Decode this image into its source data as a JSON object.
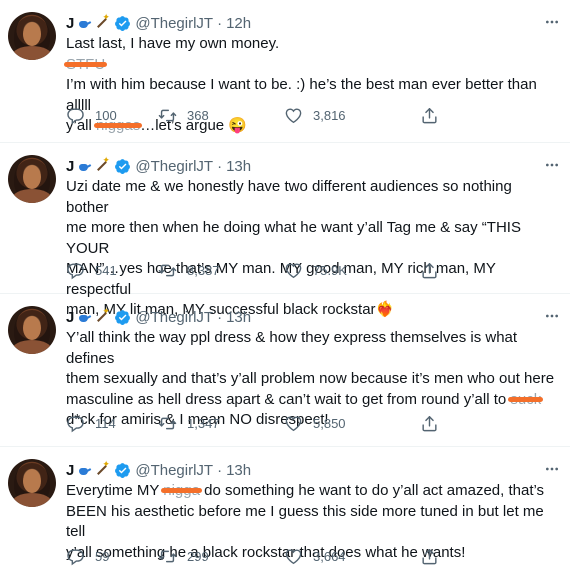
{
  "tweets": [
    {
      "name": "J",
      "handle": "@ThegirlJT",
      "separator": "·",
      "time": "12h",
      "lines": [
        {
          "text": "Last last, I have my own money."
        },
        {
          "parts": [
            {
              "redact": "STFU"
            }
          ]
        },
        {
          "text": "I’m with him because I want to be. :) he’s the best man ever better than alllll"
        },
        {
          "parts": [
            {
              "text": "y’all "
            },
            {
              "redact": "niggas"
            },
            {
              "text": "…let’s argue 😜"
            }
          ]
        }
      ],
      "replies": "100",
      "retweets": "368",
      "likes": "3,816"
    },
    {
      "name": "J",
      "handle": "@ThegirlJT",
      "separator": "·",
      "time": "13h",
      "lines": [
        {
          "text": "Uzi date me & we honestly have two different audiences so nothing bother"
        },
        {
          "text": "me more then when he doing what he want y’all Tag me & say “THIS YOUR"
        },
        {
          "text": "MAN”…yes hoe that’s MY man. MY good man, MY rich man, MY respectful"
        },
        {
          "text": "man, MY lit man, MY successful black rockstar❤️‍🔥"
        }
      ],
      "replies": "541",
      "retweets": "8,387",
      "likes": "75.9K"
    },
    {
      "name": "J",
      "handle": "@ThegirlJT",
      "separator": "·",
      "time": "13h",
      "lines": [
        {
          "text": "Y’all think the way ppl dress & how they express themselves is what defines"
        },
        {
          "text": "them sexually and that’s y’all problem now because it’s men who out here"
        },
        {
          "parts": [
            {
              "text": "masculine as hell dress apart & can’t wait to get from round y’all to "
            },
            {
              "redact": "suck"
            }
          ]
        },
        {
          "text": "d*ck for amiris & I mean NO disrespect!"
        }
      ],
      "replies": "114",
      "retweets": "1,347",
      "likes": "5,850"
    },
    {
      "name": "J",
      "handle": "@ThegirlJT",
      "separator": "·",
      "time": "13h",
      "lines": [
        {
          "parts": [
            {
              "text": "Everytime MY "
            },
            {
              "redact": "nigga"
            },
            {
              "text": " do something he want to do y’all act amazed, that’s"
            }
          ]
        },
        {
          "text": "BEEN his aesthetic before me I guess this side more tuned in but let me tell"
        },
        {
          "text": "y’all something he a black rockstar that does what he wants!"
        }
      ],
      "replies": "59",
      "retweets": "299",
      "likes": "3,664"
    }
  ],
  "icons": {
    "reply": "reply-icon",
    "retweet": "retweet-icon",
    "like": "heart-icon",
    "share": "share-icon",
    "more": "more-dots-icon",
    "verified": "verified-badge-icon"
  },
  "colors": {
    "text": "#0f1419",
    "secondary": "#536471",
    "verified": "#1d9bf0",
    "redaction": "#f46f2a"
  }
}
